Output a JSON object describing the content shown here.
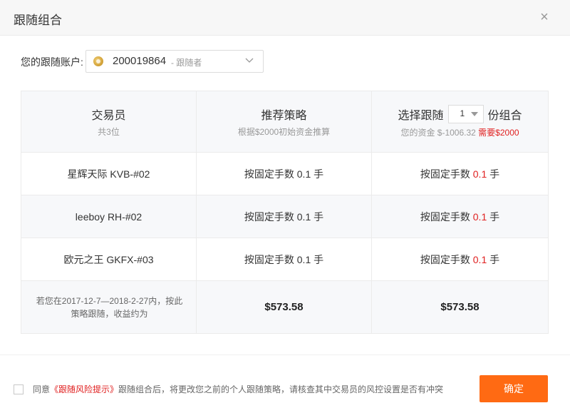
{
  "dialog": {
    "title": "跟随组合",
    "close_glyph": "×"
  },
  "account": {
    "label": "您的跟随账户:",
    "number": "200019864",
    "role": "- 跟随者"
  },
  "table": {
    "col1_header": "交易员",
    "col1_sub": "共3位",
    "col2_header": "推荐策略",
    "col2_sub": "根据$2000初始资金推算",
    "col3_prefix": "选择跟随",
    "col3_copies": "1",
    "col3_suffix": "份组合",
    "col3_funds": "您的资金 $-1006.32",
    "col3_required": "需要$2000",
    "rows": [
      {
        "trader": "星辉天际 KVB-#02",
        "rec_prefix": "按固定手数",
        "rec_value": "0.1",
        "rec_unit": "手",
        "sel_prefix": "按固定手数",
        "sel_value": "0.1",
        "sel_unit": "手"
      },
      {
        "trader": "leeboy RH-#02",
        "rec_prefix": "按固定手数",
        "rec_value": "0.1",
        "rec_unit": "手",
        "sel_prefix": "按固定手数",
        "sel_value": "0.1",
        "sel_unit": "手"
      },
      {
        "trader": "欧元之王 GKFX-#03",
        "rec_prefix": "按固定手数",
        "rec_value": "0.1",
        "rec_unit": "手",
        "sel_prefix": "按固定手数",
        "sel_value": "0.1",
        "sel_unit": "手"
      }
    ],
    "footer_text": "若您在2017-12-7—2018-2-27内，按此策略跟随，收益约为",
    "footer_rec_value": "$573.58",
    "footer_sel_value": "$573.58"
  },
  "agreement": {
    "prefix": "同意",
    "link": "《跟随风险提示》",
    "suffix": "跟随组合后，将更改您之前的个人跟随策略，请核查其中交易员的风控设置是否有冲突"
  },
  "confirm_label": "确定",
  "colors": {
    "accent": "#ff6a13",
    "highlight": "#e02020"
  }
}
